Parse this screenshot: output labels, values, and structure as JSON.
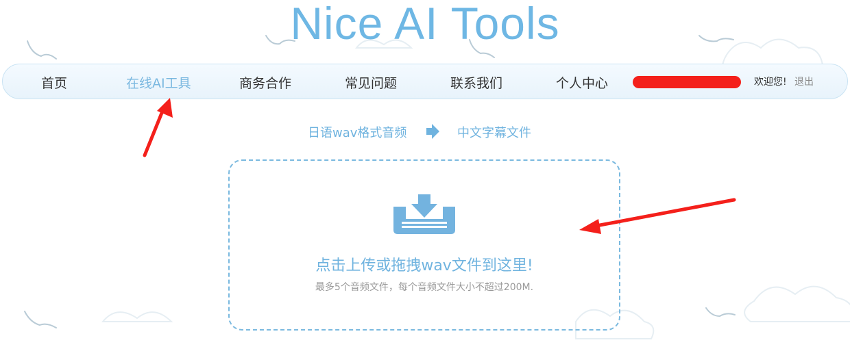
{
  "site": {
    "title": "Nice AI Tools"
  },
  "nav": {
    "items": [
      {
        "label": "首页",
        "active": false
      },
      {
        "label": "在线AI工具",
        "active": true
      },
      {
        "label": "商务合作",
        "active": false
      },
      {
        "label": "常见问题",
        "active": false
      },
      {
        "label": "联系我们",
        "active": false
      },
      {
        "label": "个人中心",
        "active": false
      }
    ],
    "welcome": "欢迎您!",
    "logout": "退出"
  },
  "flow": {
    "from": "日语wav格式音频",
    "to": "中文字幕文件"
  },
  "upload": {
    "main_text": "点击上传或拖拽wav文件到这里!",
    "sub_text": "最多5个音频文件，每个音频文件大小不超过200M."
  },
  "colors": {
    "accent": "#6eb7e4",
    "dashed_border": "#7ab9df",
    "annotation_red": "#f4201b"
  }
}
